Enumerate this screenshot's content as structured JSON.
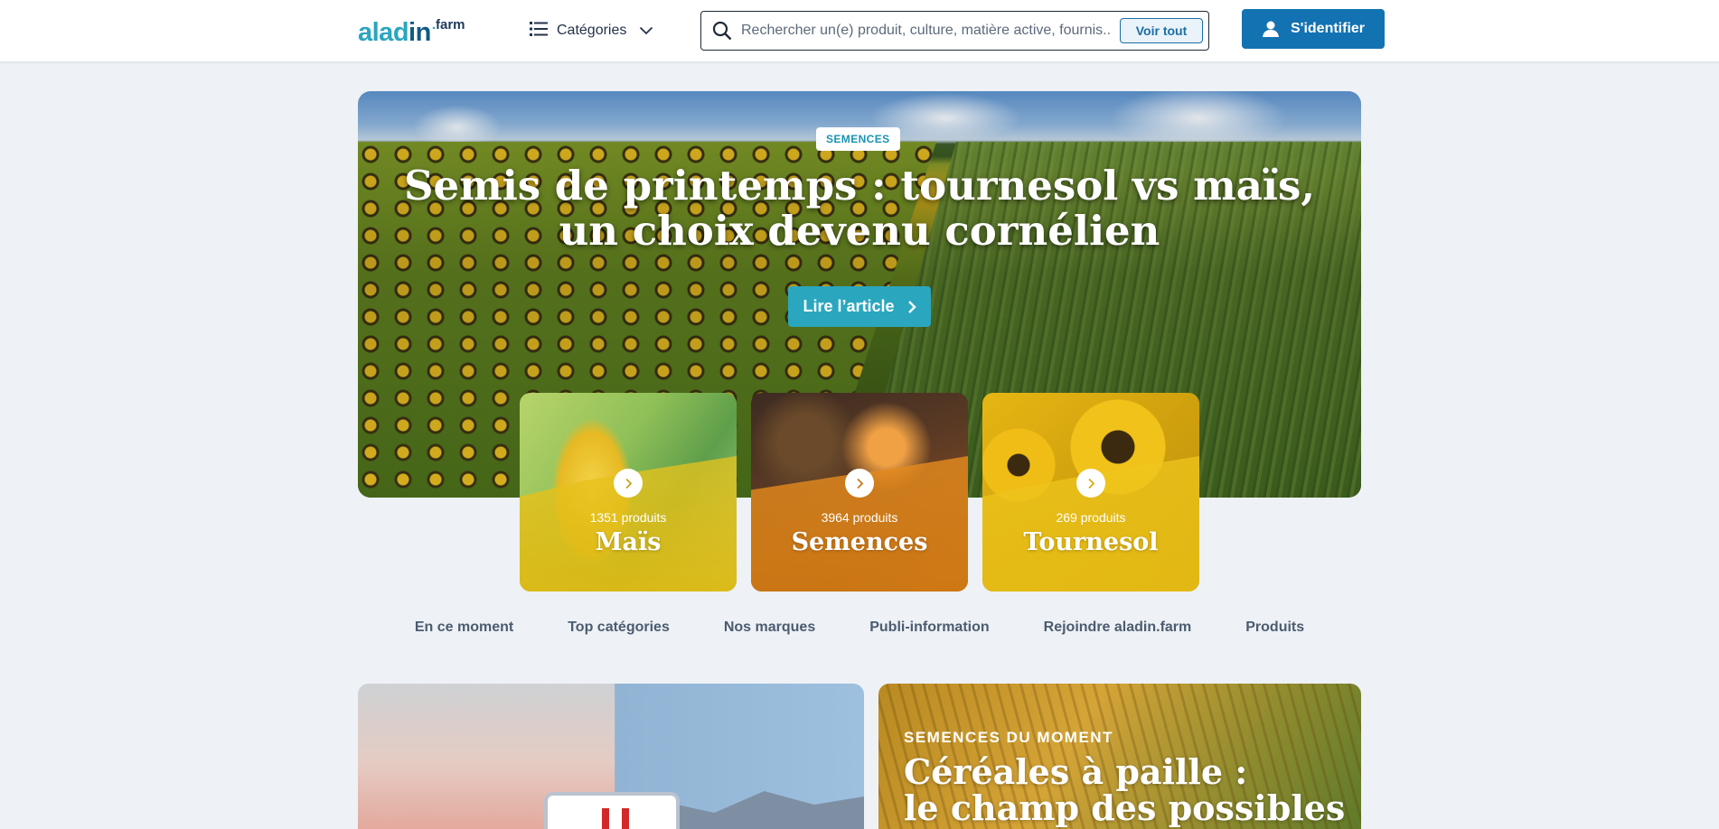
{
  "header": {
    "logo_main_left": "alad",
    "logo_main_in": "in",
    "logo_dot": ".",
    "logo_sup": "farm",
    "categories_label": "Catégories",
    "search_placeholder": "Rechercher un(e) produit, culture, matière active, fournis...",
    "search_button": "Voir tout",
    "login_label": "S'identifier"
  },
  "hero": {
    "badge": "SEMENCES",
    "title_line1": "Semis de printemps : tournesol vs maïs,",
    "title_line2": "un choix devenu cornélien",
    "button_label": "Lire l’article"
  },
  "categories": [
    {
      "count": "1351 produits",
      "name": "Maïs"
    },
    {
      "count": "3964 produits",
      "name": "Semences"
    },
    {
      "count": "269 produits",
      "name": "Tournesol"
    }
  ],
  "tabs": [
    "En ce moment",
    "Top catégories",
    "Nos marques",
    "Publi-information",
    "Rejoindre aladin.farm",
    "Produits"
  ],
  "promo2": {
    "kicker": "SEMENCES DU MOMENT",
    "title_line1": "Céréales à paille :",
    "title_line2": "le champ des possibles"
  },
  "colors": {
    "brand_teal": "#2aa6c0",
    "brand_blue": "#1372b2",
    "page_bg": "#eef1f5"
  },
  "icons": [
    "list-icon",
    "chevron-down-icon",
    "search-icon",
    "user-icon",
    "chevron-right-icon"
  ]
}
